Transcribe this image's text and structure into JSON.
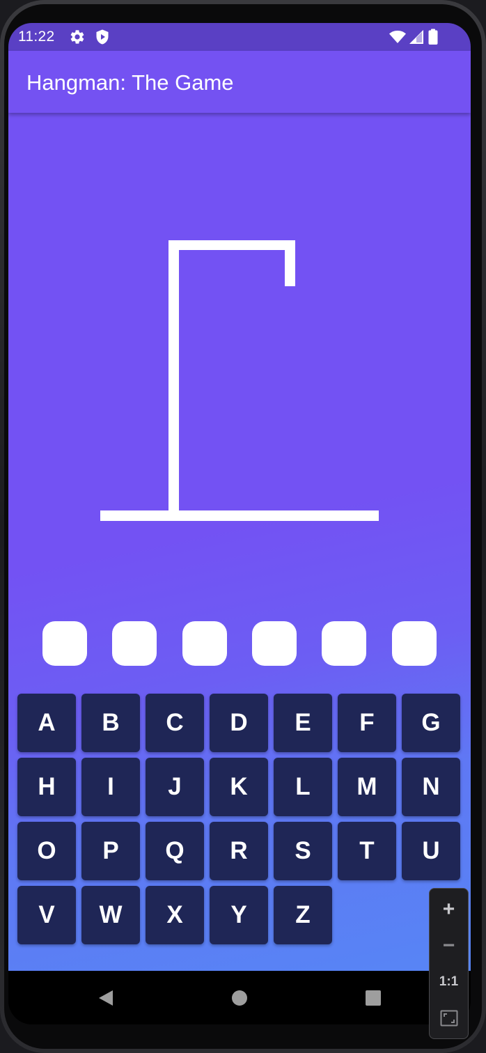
{
  "status_bar": {
    "time": "11:22",
    "left_icons": [
      "gear-icon",
      "shield-play-icon"
    ],
    "right_icons": [
      "wifi-icon",
      "signal-icon",
      "battery-icon"
    ],
    "background": "#5a40c4"
  },
  "app_bar": {
    "title": "Hangman: The Game",
    "background": "#7452f2"
  },
  "game": {
    "word_slot_count": 6,
    "revealed_letters": [
      "",
      "",
      "",
      "",
      "",
      ""
    ],
    "wrong_guesses": 0,
    "background_top": "#7352f3",
    "background_bottom": "#5785f5",
    "gallows_color": "#ffffff"
  },
  "keyboard": {
    "keys": [
      "A",
      "B",
      "C",
      "D",
      "E",
      "F",
      "G",
      "H",
      "I",
      "J",
      "K",
      "L",
      "M",
      "N",
      "O",
      "P",
      "Q",
      "R",
      "S",
      "T",
      "U",
      "V",
      "W",
      "X",
      "Y",
      "Z"
    ],
    "key_background": "#1f2656",
    "key_text_color": "#ffffff"
  },
  "navigation_bar": {
    "buttons": [
      "back-icon",
      "home-icon",
      "recents-icon"
    ]
  },
  "emulator_zoom_controls": {
    "zoom_in": "+",
    "zoom_out": "−",
    "actual_size": "1:1",
    "fit_icon": "fit-screen-icon"
  }
}
